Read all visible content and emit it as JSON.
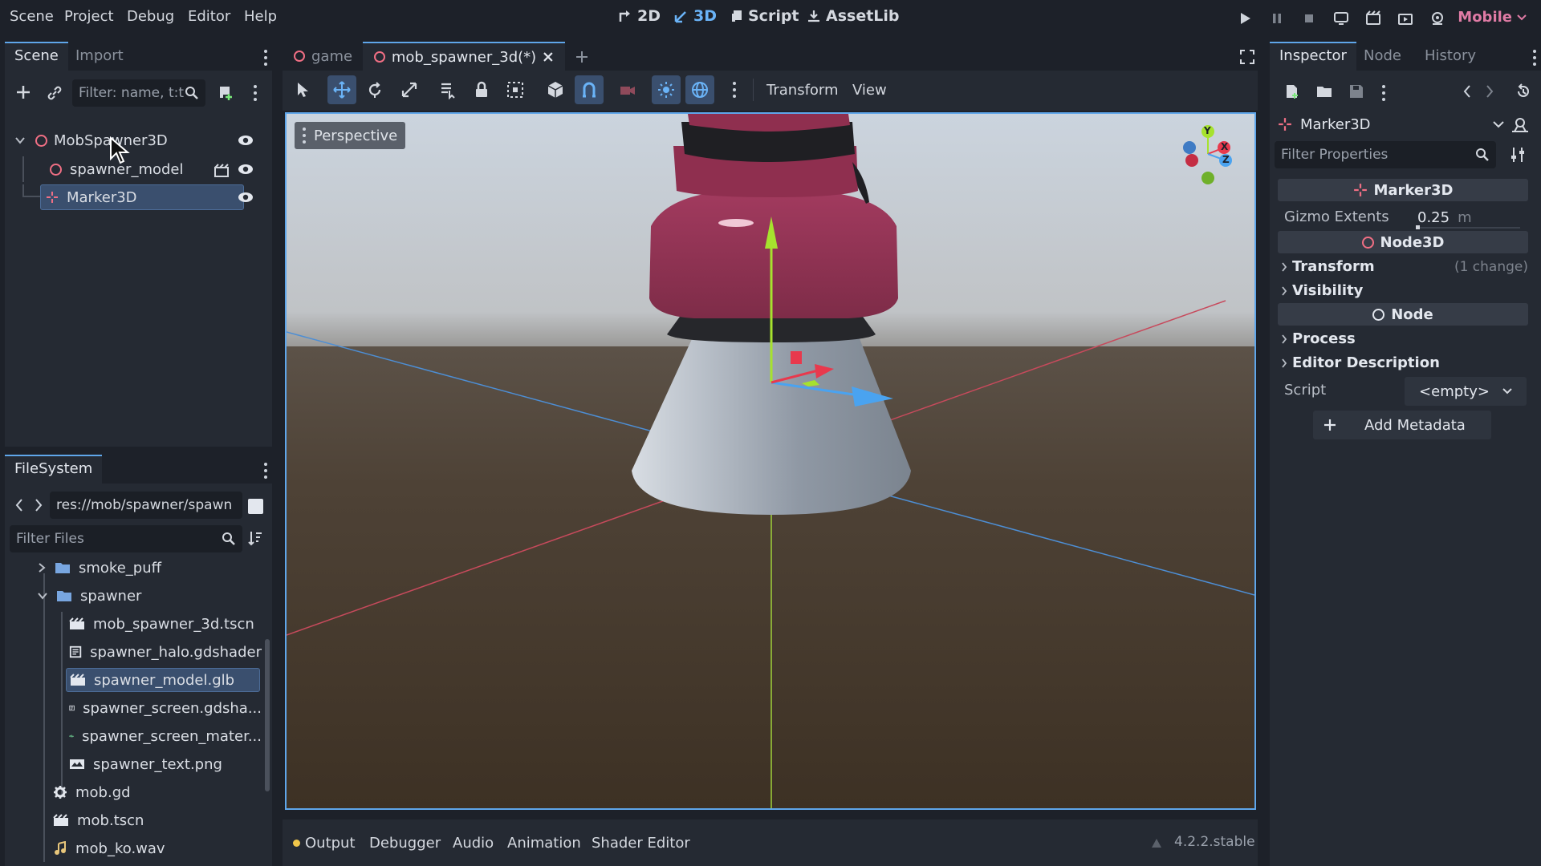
{
  "menu": {
    "items": [
      "Scene",
      "Project",
      "Debug",
      "Editor",
      "Help"
    ]
  },
  "workspaces": {
    "2d": "2D",
    "3d": "3D",
    "script": "Script",
    "assetlib": "AssetLib"
  },
  "renderer": "Mobile",
  "scene_dock": {
    "tabs": [
      "Scene",
      "Import"
    ],
    "filter_placeholder": "Filter: name, t:t",
    "nodes": [
      {
        "label": "MobSpawner3D",
        "depth": 0,
        "icon": "node3d-icon"
      },
      {
        "label": "spawner_model",
        "depth": 1,
        "icon": "node3d-icon"
      },
      {
        "label": "Marker3D",
        "depth": 1,
        "icon": "marker3d-icon"
      }
    ]
  },
  "filesystem": {
    "tab": "FileSystem",
    "path": "res://mob/spawner/spawn",
    "filter_placeholder": "Filter Files",
    "items": [
      {
        "label": "smoke_puff",
        "type": "folder"
      },
      {
        "label": "spawner",
        "type": "folder"
      },
      {
        "label": "mob_spawner_3d.tscn",
        "type": "scene"
      },
      {
        "label": "spawner_halo.gdshader",
        "type": "shader"
      },
      {
        "label": "spawner_model.glb",
        "type": "scene"
      },
      {
        "label": "spawner_screen.gdsha...",
        "type": "shader"
      },
      {
        "label": "spawner_screen_mater...",
        "type": "material"
      },
      {
        "label": "spawner_text.png",
        "type": "image"
      },
      {
        "label": "mob.gd",
        "type": "script"
      },
      {
        "label": "mob.tscn",
        "type": "scene"
      },
      {
        "label": "mob_ko.wav",
        "type": "audio"
      }
    ]
  },
  "editor_tabs": [
    {
      "label": "game"
    },
    {
      "label": "mob_spawner_3d(*)"
    }
  ],
  "viewport_toolbar": {
    "transform": "Transform",
    "view": "View"
  },
  "viewport": {
    "perspective_label": "Perspective",
    "gizmo_axes": [
      "Y",
      "X",
      "Z"
    ]
  },
  "inspector": {
    "tabs": [
      "Inspector",
      "Node",
      "History"
    ],
    "selected_node": "Marker3D",
    "filter_placeholder": "Filter Properties",
    "class_marker": "Marker3D",
    "gizmo_extents_label": "Gizmo Extents",
    "gizmo_extents_value": "0.25",
    "gizmo_extents_unit": "m",
    "class_node3d": "Node3D",
    "transform_label": "Transform",
    "transform_changes": "(1 change)",
    "visibility_label": "Visibility",
    "class_node": "Node",
    "process_label": "Process",
    "editor_description_label": "Editor Description",
    "script_label": "Script",
    "script_value": "<empty>",
    "add_metadata": "Add Metadata"
  },
  "bottom_panel": {
    "tabs": [
      "Output",
      "Debugger",
      "Audio",
      "Animation",
      "Shader Editor"
    ],
    "version": "4.2.2.stable"
  },
  "colors": {
    "accent": "#5fa6ea",
    "node3d": "#f06f84",
    "renderer": "#e07ba5"
  }
}
